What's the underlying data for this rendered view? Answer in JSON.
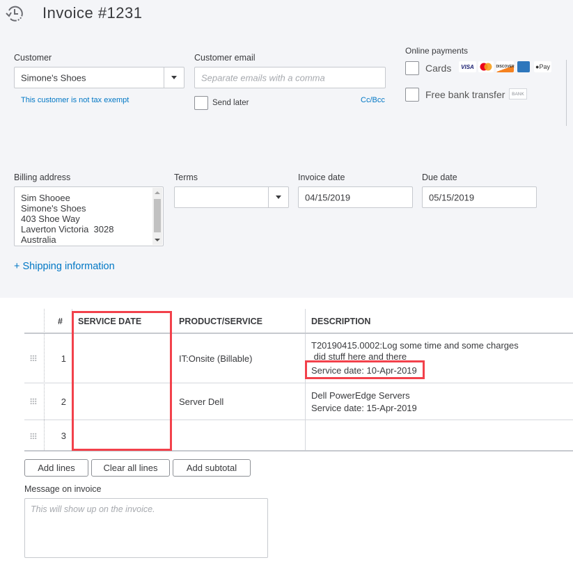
{
  "header": {
    "title": "Invoice #1231",
    "history_icon": "history-clock-icon"
  },
  "customer": {
    "label": "Customer",
    "value": "Simone's Shoes",
    "tax_note": "This customer is not tax exempt"
  },
  "email": {
    "label": "Customer email",
    "placeholder": "Separate emails with a comma",
    "send_later_label": "Send later",
    "cc_bcc_label": "Cc/Bcc"
  },
  "online_payments": {
    "label": "Online payments",
    "cards_label": "Cards",
    "card_logos": [
      "VISA",
      "Mastercard",
      "DISCOVER",
      "AMEX",
      "Pay"
    ],
    "bank_label": "Free bank transfer",
    "bank_badge": "BANK"
  },
  "billing": {
    "label": "Billing address",
    "address": "Sim Shooee\nSimone's Shoes\n403 Shoe Way\nLaverton Victoria  3028\nAustralia"
  },
  "terms": {
    "label": "Terms",
    "value": ""
  },
  "invoice_date": {
    "label": "Invoice date",
    "value": "04/15/2019"
  },
  "due_date": {
    "label": "Due date",
    "value": "05/15/2019"
  },
  "shipping_link": "+ Shipping information",
  "table": {
    "headers": {
      "num": "#",
      "service_date": "SERVICE DATE",
      "product": "PRODUCT/SERVICE",
      "description": "DESCRIPTION"
    },
    "rows": [
      {
        "num": "1",
        "service_date": "",
        "product": "IT:Onsite (Billable)",
        "desc_line1": "T20190415.0002:Log some time and some charges",
        "desc_line2": " did stuff here and there",
        "desc_line3": "Service date: 10-Apr-2019"
      },
      {
        "num": "2",
        "service_date": "",
        "product": "Server Dell",
        "desc_line1": "Dell PowerEdge Servers",
        "desc_line2": "Service date: 15-Apr-2019",
        "desc_line3": ""
      },
      {
        "num": "3",
        "service_date": "",
        "product": "",
        "desc_line1": "",
        "desc_line2": "",
        "desc_line3": ""
      }
    ]
  },
  "buttons": {
    "add_lines": "Add lines",
    "clear_all": "Clear all lines",
    "add_subtotal": "Add subtotal"
  },
  "message": {
    "label": "Message on invoice",
    "placeholder": "This will show up on the invoice."
  },
  "colors": {
    "link": "#0077c5",
    "highlight": "#f2414b",
    "panel_bg": "#f4f5f8"
  }
}
